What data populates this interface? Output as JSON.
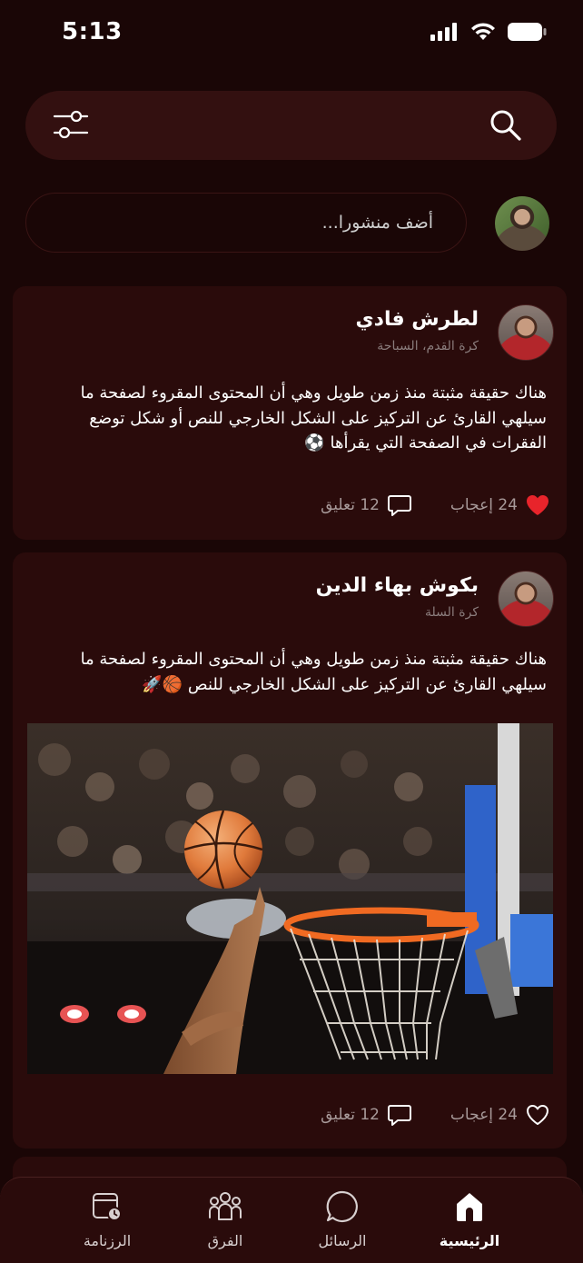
{
  "status_bar": {
    "time": "5:13"
  },
  "composer": {
    "placeholder": "أضف منشورا..."
  },
  "posts": [
    {
      "author": "لطرش فادي",
      "sports": "كرة القدم، السباحة",
      "text": "هناك حقيقة مثبتة منذ زمن طويل وهي أن المحتوى المقروء لصفحة ما سيلهي  القارئ عن التركيز على الشكل الخارجي للنص أو شكل توضع الفقرات في الصفحة  التي يقرأها ⚽",
      "likes": "24 إعجاب",
      "comments": "12 تعليق",
      "liked": true
    },
    {
      "author": "بكوش بهاء الدين",
      "sports": "كرة السلة",
      "text": "هناك حقيقة مثبتة منذ زمن طويل وهي أن المحتوى المقروء لصفحة ما سيلهي  القارئ عن التركيز على الشكل الخارجي للنص 🏀🚀",
      "likes": "24 إعجاب",
      "comments": "12 تعليق",
      "liked": false
    }
  ],
  "bottom_nav": {
    "home": "الرئيسية",
    "messages": "الرسائل",
    "teams": "الفرق",
    "schedule": "الرزنامة"
  },
  "colors": {
    "background": "#1a0606",
    "card": "#2a0b0b",
    "like_active": "#e8242b"
  },
  "icons": [
    "filter-icon",
    "search-icon",
    "heart-icon",
    "comment-icon",
    "home-icon",
    "messages-icon",
    "teams-icon",
    "schedule-icon"
  ]
}
